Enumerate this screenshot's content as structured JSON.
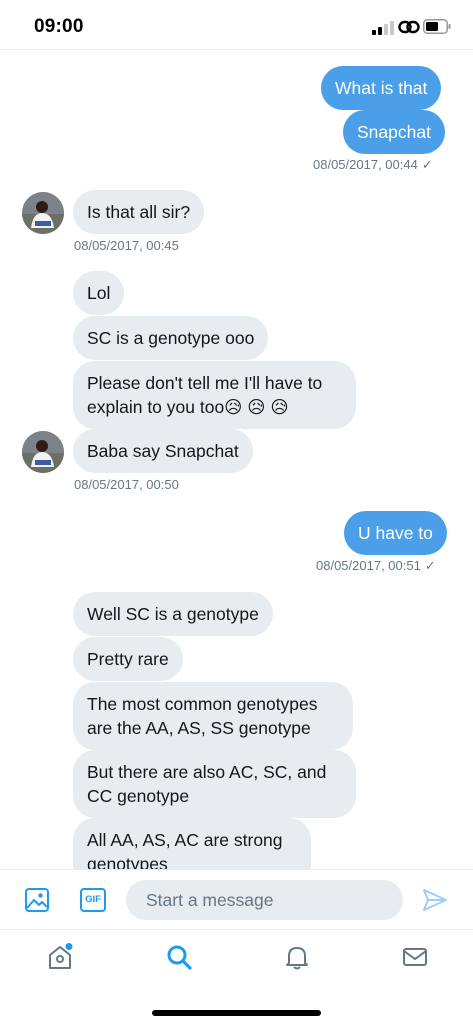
{
  "status_bar": {
    "time": "09:00"
  },
  "chat": {
    "messages": [
      {
        "text": "What is that"
      },
      {
        "text": "Snapchat"
      },
      {
        "text": "Is that all sir?"
      },
      {
        "text": "Lol"
      },
      {
        "text": "SC is a genotype ooo"
      },
      {
        "text": "Please don't tell me I'll have to explain to you too😥 😥 😥"
      },
      {
        "text": "Baba say Snapchat"
      },
      {
        "text": "U have to"
      },
      {
        "text": "Well SC is a genotype"
      },
      {
        "text": "Pretty rare"
      },
      {
        "text": "The most common genotypes are the AA, AS, SS genotype"
      },
      {
        "text": "But there are also AC, SC, and CC genotype"
      },
      {
        "text": "All AA, AS, AC are strong genotypes"
      }
    ],
    "timestamps": {
      "t1": "08/05/2017, 00:44",
      "t2": "08/05/2017, 00:45",
      "t3": "08/05/2017, 00:50",
      "t4": "08/05/2017, 00:51"
    },
    "read_check": "✓"
  },
  "composer": {
    "gif_label": "GIF",
    "placeholder": "Start a message"
  },
  "colors": {
    "accent": "#1d9bf0",
    "outgoing_bubble": "#4a9fe8",
    "incoming_bubble": "#e6ecf0",
    "muted_text": "#657786"
  },
  "icons": {
    "composer": [
      "image-icon",
      "gif-icon",
      "send-icon"
    ],
    "tabs": [
      "home-icon",
      "search-icon",
      "notifications-icon",
      "messages-icon"
    ]
  },
  "tabbar": {
    "active_tab": "search"
  }
}
